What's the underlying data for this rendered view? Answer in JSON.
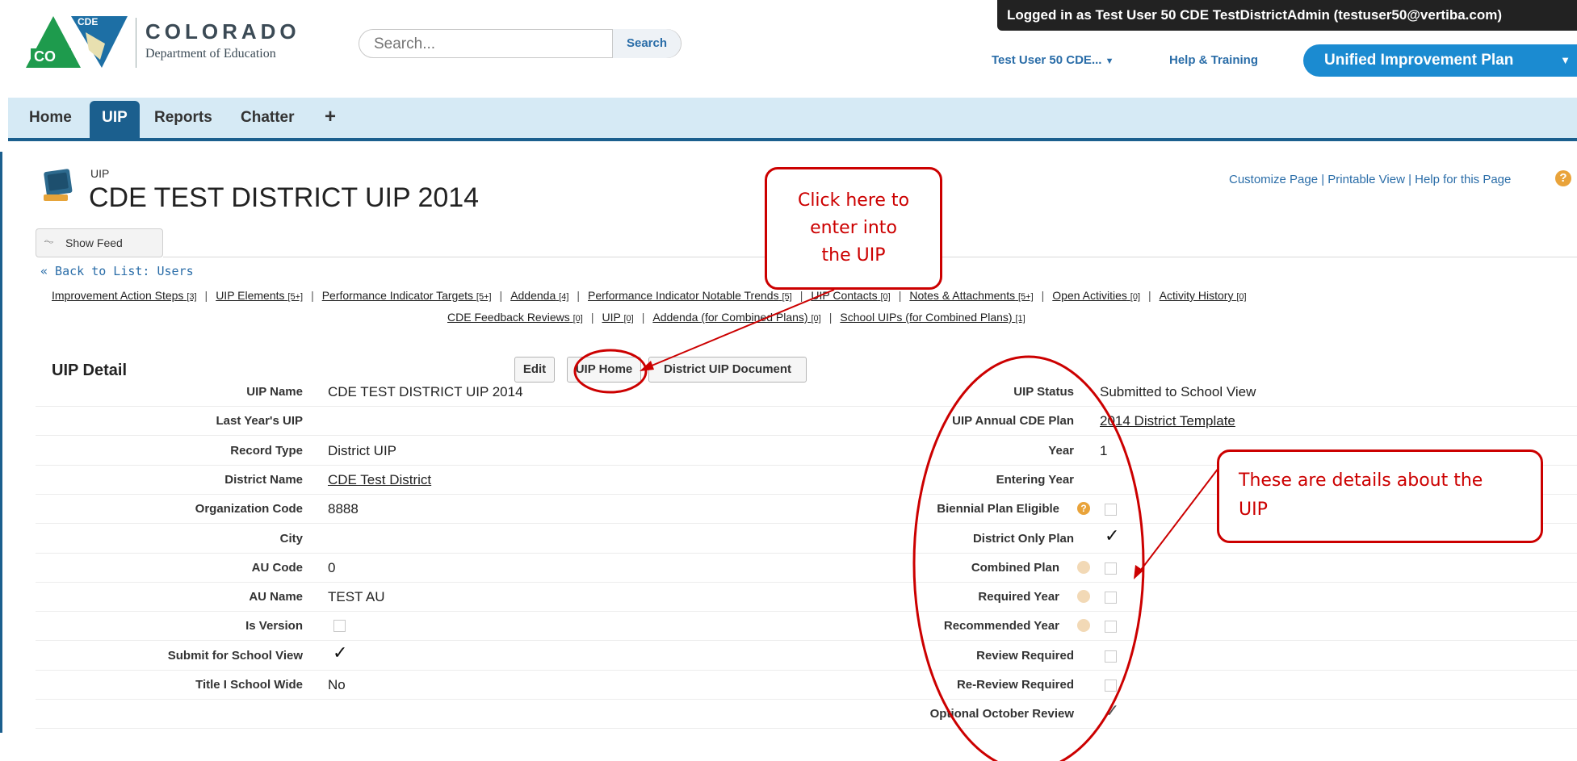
{
  "header": {
    "logo_badge": "CDE",
    "logo_co": "CO",
    "logo_title": "COLORADO",
    "logo_subtitle": "Department of Education",
    "search_placeholder": "Search...",
    "search_button": "Search",
    "logged_in": "Logged in as Test User 50 CDE TestDistrictAdmin (testuser50@vertiba.com)",
    "user_menu": "Test User 50 CDE...",
    "help_link": "Help & Training",
    "app_menu": "Unified Improvement Plan"
  },
  "tabs": [
    {
      "label": "Home"
    },
    {
      "label": "UIP"
    },
    {
      "label": "Reports"
    },
    {
      "label": "Chatter"
    },
    {
      "label": "+"
    }
  ],
  "page": {
    "type_label": "UIP",
    "title": "CDE TEST DISTRICT UIP 2014",
    "top_links": "Customize Page | Printable View | Help for this Page",
    "show_feed": "Show Feed",
    "back_link": "« Back to List: Users"
  },
  "related_lists": {
    "row1": [
      {
        "label": "Improvement Action Steps",
        "count": "[3]"
      },
      {
        "label": "UIP Elements",
        "count": "[5+]"
      },
      {
        "label": "Performance Indicator Targets",
        "count": "[5+]"
      },
      {
        "label": "Addenda",
        "count": "[4]"
      },
      {
        "label": "Performance Indicator Notable Trends",
        "count": "[5]"
      },
      {
        "label": "UIP Contacts",
        "count": "[0]"
      },
      {
        "label": "Notes & Attachments",
        "count": "[5+]"
      },
      {
        "label": "Open Activities",
        "count": "[0]"
      },
      {
        "label": "Activity History",
        "count": "[0]"
      }
    ],
    "row2": [
      {
        "label": "CDE Feedback Reviews",
        "count": "[0]"
      },
      {
        "label": "UIP",
        "count": "[0]"
      },
      {
        "label": "Addenda (for Combined Plans)",
        "count": "[0]"
      },
      {
        "label": "School UIPs (for Combined Plans)",
        "count": "[1]"
      }
    ]
  },
  "detail": {
    "title": "UIP Detail",
    "buttons": {
      "edit": "Edit",
      "uip_home": "UIP Home",
      "district_doc": "District UIP Document"
    },
    "left": [
      {
        "label": "UIP Name",
        "value": "CDE TEST DISTRICT UIP 2014"
      },
      {
        "label": "Last Year's UIP",
        "value": ""
      },
      {
        "label": "Record Type",
        "value": "District UIP"
      },
      {
        "label": "District Name",
        "value": "CDE Test District"
      },
      {
        "label": "Organization Code",
        "value": "8888"
      },
      {
        "label": "City",
        "value": ""
      },
      {
        "label": "AU Code",
        "value": "0"
      },
      {
        "label": "AU Name",
        "value": "TEST AU"
      },
      {
        "label": "Is Version",
        "value": ""
      },
      {
        "label": "Submit for School View",
        "value": ""
      },
      {
        "label": "Title I School Wide",
        "value": "No"
      }
    ],
    "right": [
      {
        "label": "UIP Status",
        "value": "Submitted to School View"
      },
      {
        "label": "UIP Annual CDE Plan",
        "value": "2014 District Template"
      },
      {
        "label": "Year",
        "value": "1"
      },
      {
        "label": "Entering Year",
        "value": ""
      },
      {
        "label": "Biennial Plan Eligible",
        "value": ""
      },
      {
        "label": "District Only Plan",
        "value": ""
      },
      {
        "label": "Combined Plan",
        "value": ""
      },
      {
        "label": "Required Year",
        "value": ""
      },
      {
        "label": "Recommended Year",
        "value": ""
      },
      {
        "label": "Review Required",
        "value": ""
      },
      {
        "label": "Re-Review Required",
        "value": ""
      },
      {
        "label": "Optional October Review",
        "value": ""
      }
    ]
  },
  "annotations": {
    "callout1": [
      "Click here to",
      "enter into",
      "the UIP"
    ],
    "callout2": [
      "These are details about the",
      "UIP"
    ]
  },
  "colors": {
    "brand_blue": "#1b8bd1",
    "tab_dark": "#1b5f8e",
    "annotation_red": "#cc0000"
  },
  "icons": [
    "cde-logo-icon",
    "uip-page-icon",
    "feed-pulse-icon",
    "help-question-icon",
    "info-icon",
    "checkmark-icon",
    "dropdown-caret-icon"
  ]
}
